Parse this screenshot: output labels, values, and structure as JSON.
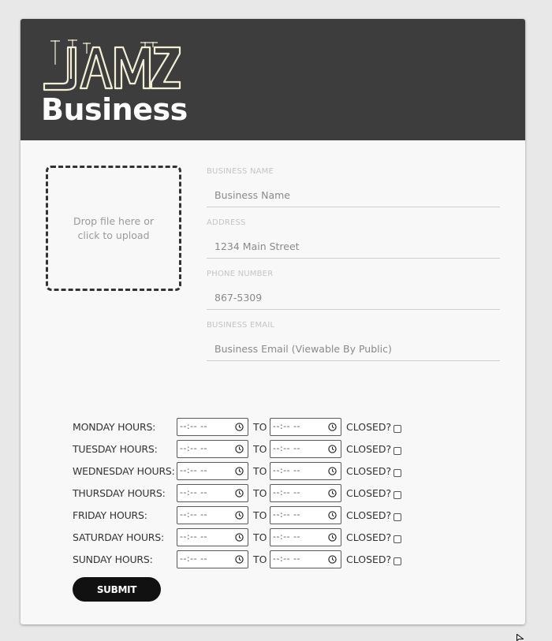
{
  "header": {
    "logo_text": "JAMZ",
    "subtitle": "Business",
    "bg_color": "#3d3d3d",
    "logo_color": "#f3efd7"
  },
  "upload": {
    "label": "Drop file here or click to upload"
  },
  "fields": [
    {
      "label": "BUSINESS NAME",
      "placeholder": "Business Name"
    },
    {
      "label": "ADDRESS",
      "placeholder": "1234 Main Street"
    },
    {
      "label": "PHONE NUMBER",
      "placeholder": "867-5309"
    },
    {
      "label": "BUSINESS EMAIL",
      "placeholder": "Business Email (Viewable By Public)"
    }
  ],
  "hours": {
    "time_placeholder": "--:-- --",
    "to_label": "TO",
    "closed_label": "CLOSED?",
    "days": [
      "MONDAY HOURS:",
      "TUESDAY HOURS:",
      "WEDNESDAY HOURS:",
      "THURSDAY HOURS:",
      "FRIDAY HOURS:",
      "SATURDAY HOURS:",
      "SUNDAY HOURS:"
    ]
  },
  "submit_label": "SUBMIT"
}
